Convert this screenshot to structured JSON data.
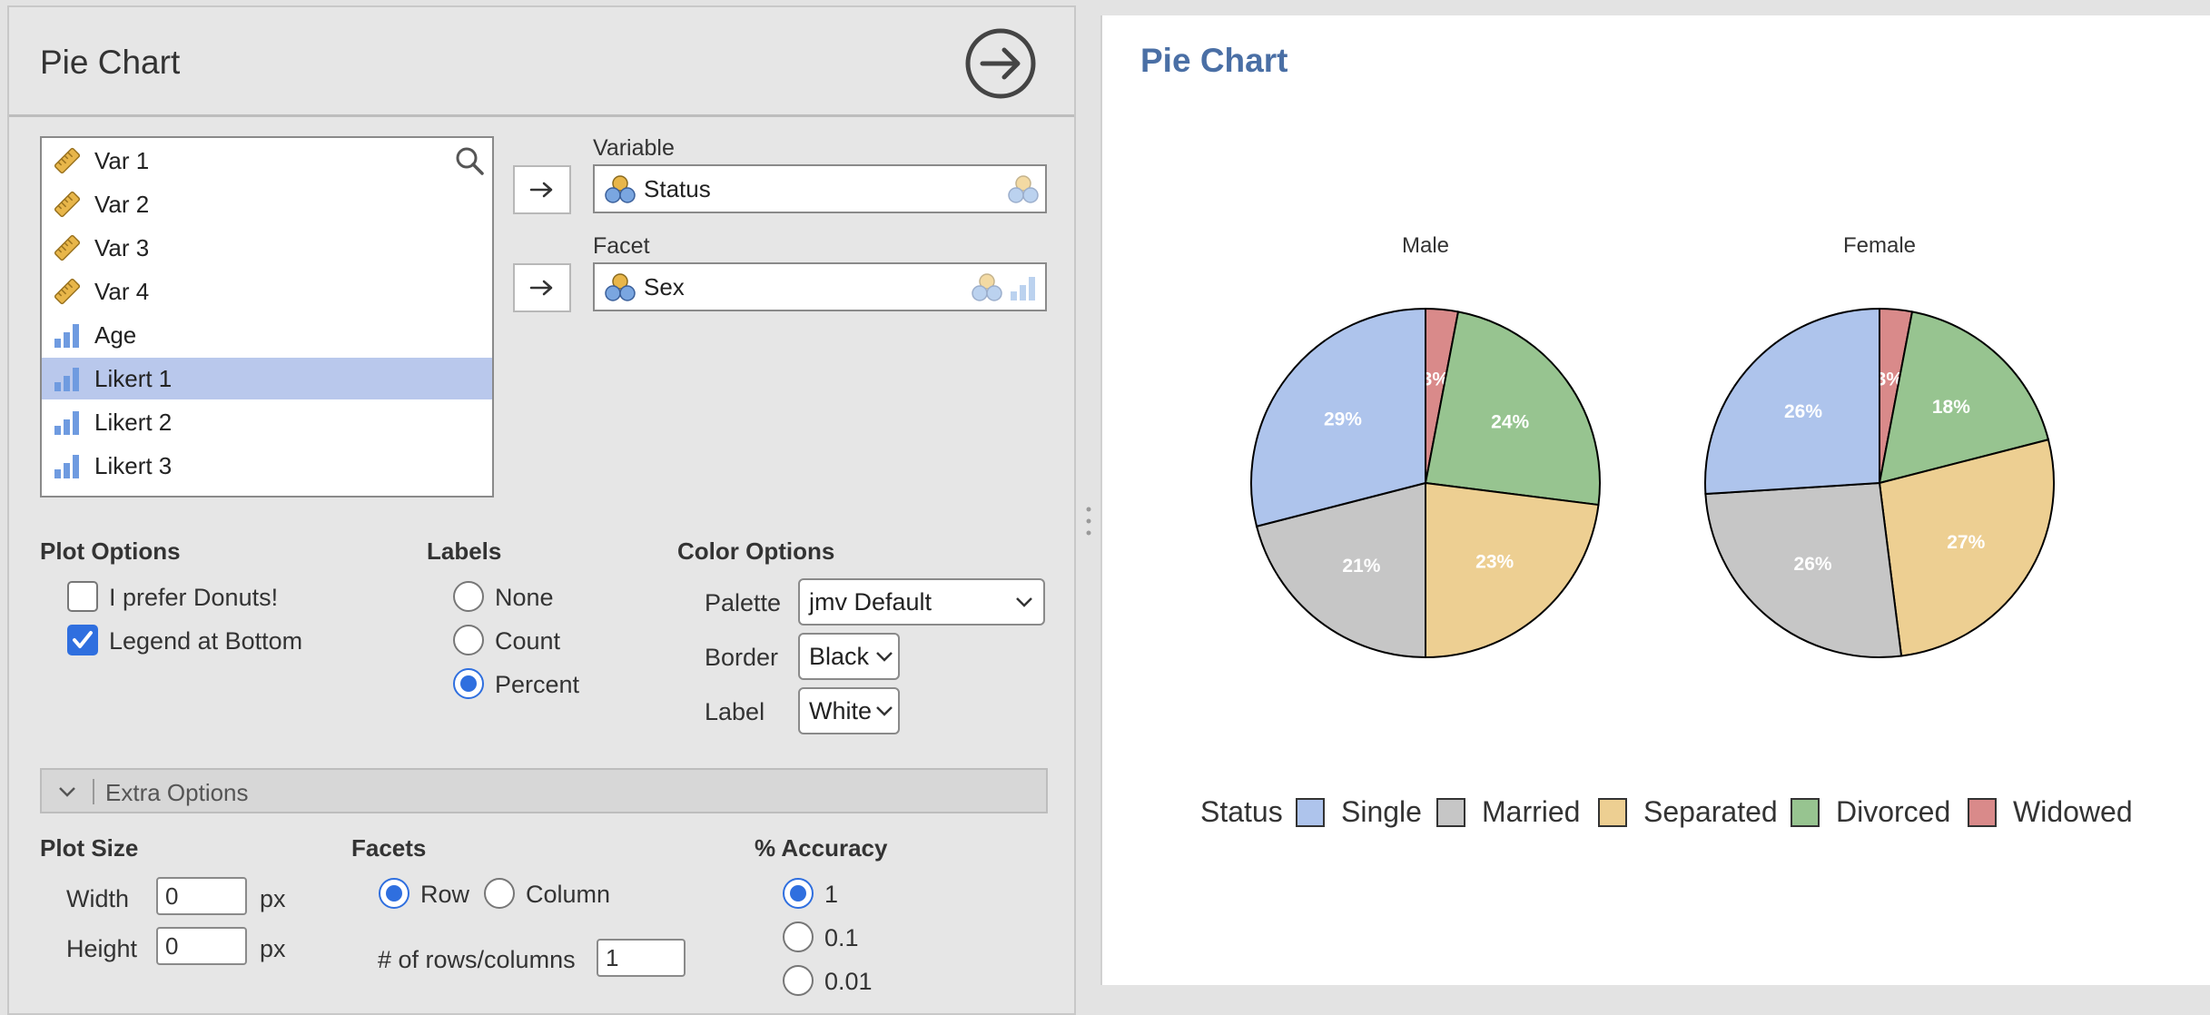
{
  "left_panel": {
    "title": "Pie Chart",
    "variables": [
      {
        "label": "Var 1",
        "icon": "ruler-icon"
      },
      {
        "label": "Var 2",
        "icon": "ruler-icon"
      },
      {
        "label": "Var 3",
        "icon": "ruler-icon"
      },
      {
        "label": "Var 4",
        "icon": "ruler-icon"
      },
      {
        "label": "Age",
        "icon": "bar-ordinal-icon"
      },
      {
        "label": "Likert 1",
        "icon": "bar-ordinal-icon",
        "selected": true
      },
      {
        "label": "Likert 2",
        "icon": "bar-ordinal-icon"
      },
      {
        "label": "Likert 3",
        "icon": "bar-ordinal-icon"
      }
    ],
    "variable_label": "Variable",
    "variable_value": "Status",
    "facet_label": "Facet",
    "facet_value": "Sex",
    "plot_options": {
      "header": "Plot Options",
      "donut_label": "I prefer Donuts!",
      "donut_checked": false,
      "legend_bottom_label": "Legend at Bottom",
      "legend_bottom_checked": true
    },
    "labels": {
      "header": "Labels",
      "options": [
        "None",
        "Count",
        "Percent"
      ],
      "selected": "Percent"
    },
    "color_options": {
      "header": "Color Options",
      "palette_label": "Palette",
      "palette_value": "jmv Default",
      "border_label": "Border",
      "border_value": "Black",
      "label_label": "Label",
      "label_value": "White"
    },
    "extra_options_label": "Extra Options",
    "plot_size": {
      "header": "Plot Size",
      "width_label": "Width",
      "width_value": "0",
      "height_label": "Height",
      "height_value": "0",
      "unit": "px"
    },
    "facets": {
      "header": "Facets",
      "row_label": "Row",
      "column_label": "Column",
      "selected": "Row",
      "rows_cols_label": "# of rows/columns",
      "rows_cols_value": "1"
    },
    "accuracy": {
      "header": "% Accuracy",
      "options": [
        "1",
        "0.1",
        "0.01"
      ],
      "selected": "1"
    }
  },
  "results": {
    "title": "Pie Chart"
  },
  "colors": {
    "accent": "#2f6fdf",
    "results_title": "#4a6fa5",
    "selected_row": "#b9c8ec"
  },
  "chart_data": {
    "type": "pie",
    "facets": [
      {
        "name": "Male",
        "slices": [
          {
            "category": "Widowed",
            "value": 3,
            "label": "3%"
          },
          {
            "category": "Divorced",
            "value": 24,
            "label": "24%"
          },
          {
            "category": "Separated",
            "value": 23,
            "label": "23%"
          },
          {
            "category": "Married",
            "value": 21,
            "label": "21%"
          },
          {
            "category": "Single",
            "value": 29,
            "label": "29%"
          }
        ]
      },
      {
        "name": "Female",
        "slices": [
          {
            "category": "Widowed",
            "value": 3,
            "label": "3%"
          },
          {
            "category": "Divorced",
            "value": 18,
            "label": "18%"
          },
          {
            "category": "Separated",
            "value": 27,
            "label": "27%"
          },
          {
            "category": "Married",
            "value": 26,
            "label": "26%"
          },
          {
            "category": "Single",
            "value": 26,
            "label": "26%"
          }
        ]
      }
    ],
    "legend_title": "Status",
    "legend": [
      {
        "name": "Single",
        "color": "#aec4ec"
      },
      {
        "name": "Married",
        "color": "#c6c6c6"
      },
      {
        "name": "Separated",
        "color": "#edcf92"
      },
      {
        "name": "Divorced",
        "color": "#97c490"
      },
      {
        "name": "Widowed",
        "color": "#d98a8a"
      }
    ],
    "legend_position": "bottom",
    "border_color": "#000000",
    "label_color": "#ffffff"
  }
}
